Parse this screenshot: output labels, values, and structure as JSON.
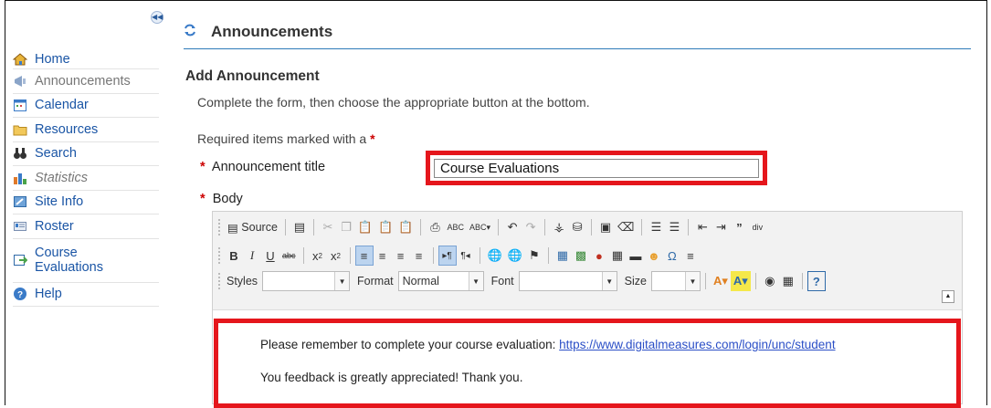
{
  "sidebar": {
    "collapse_icon": "double-chevron-left-icon",
    "items": [
      {
        "label": "Home",
        "icon": "home-icon"
      },
      {
        "label": "Announcements",
        "icon": "announcement-icon"
      },
      {
        "label": "Calendar",
        "icon": "calendar-icon"
      },
      {
        "label": "Resources",
        "icon": "folder-icon"
      },
      {
        "label": "Search",
        "icon": "binoculars-icon"
      },
      {
        "label": "Statistics",
        "icon": "bar-chart-icon"
      },
      {
        "label": "Site Info",
        "icon": "site-info-icon"
      },
      {
        "label": "Roster",
        "icon": "roster-icon"
      },
      {
        "label": "Course Evaluations",
        "icon": "external-link-icon"
      },
      {
        "label": "Help",
        "icon": "help-icon"
      }
    ]
  },
  "main": {
    "tool_title": "Announcements",
    "heading": "Add Announcement",
    "instructions": "Complete the form, then choose the appropriate button at the bottom.",
    "required_note": "Required items marked with a",
    "required_star": "*",
    "title_label": "Announcement title",
    "title_value": "Course Evaluations",
    "body_label": "Body"
  },
  "editor": {
    "source_label": "Source",
    "styles_label": "Styles",
    "format_label": "Format",
    "format_value": "Normal",
    "font_label": "Font",
    "font_value": "",
    "size_label": "Size",
    "size_value": "",
    "body_line1_text": "Please remember to complete your course evaluation: ",
    "body_line1_link": "https://www.digitalmeasures.com/login/unc/student",
    "body_line2": "You feedback is greatly appreciated! Thank you."
  },
  "colors": {
    "accent": "#2e7bb8",
    "highlight": "#e5161c",
    "link": "#1a55a5",
    "required": "#cc0000"
  }
}
